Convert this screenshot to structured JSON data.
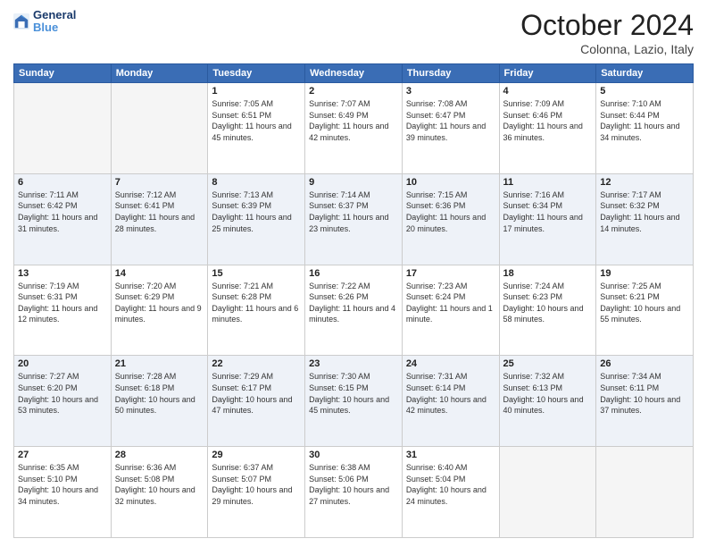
{
  "header": {
    "logo_general": "General",
    "logo_blue": "Blue",
    "month_title": "October 2024",
    "location": "Colonna, Lazio, Italy"
  },
  "days_of_week": [
    "Sunday",
    "Monday",
    "Tuesday",
    "Wednesday",
    "Thursday",
    "Friday",
    "Saturday"
  ],
  "weeks": [
    {
      "shade": false,
      "days": [
        {
          "num": "",
          "detail": ""
        },
        {
          "num": "",
          "detail": ""
        },
        {
          "num": "1",
          "detail": "Sunrise: 7:05 AM\nSunset: 6:51 PM\nDaylight: 11 hours and 45 minutes."
        },
        {
          "num": "2",
          "detail": "Sunrise: 7:07 AM\nSunset: 6:49 PM\nDaylight: 11 hours and 42 minutes."
        },
        {
          "num": "3",
          "detail": "Sunrise: 7:08 AM\nSunset: 6:47 PM\nDaylight: 11 hours and 39 minutes."
        },
        {
          "num": "4",
          "detail": "Sunrise: 7:09 AM\nSunset: 6:46 PM\nDaylight: 11 hours and 36 minutes."
        },
        {
          "num": "5",
          "detail": "Sunrise: 7:10 AM\nSunset: 6:44 PM\nDaylight: 11 hours and 34 minutes."
        }
      ]
    },
    {
      "shade": true,
      "days": [
        {
          "num": "6",
          "detail": "Sunrise: 7:11 AM\nSunset: 6:42 PM\nDaylight: 11 hours and 31 minutes."
        },
        {
          "num": "7",
          "detail": "Sunrise: 7:12 AM\nSunset: 6:41 PM\nDaylight: 11 hours and 28 minutes."
        },
        {
          "num": "8",
          "detail": "Sunrise: 7:13 AM\nSunset: 6:39 PM\nDaylight: 11 hours and 25 minutes."
        },
        {
          "num": "9",
          "detail": "Sunrise: 7:14 AM\nSunset: 6:37 PM\nDaylight: 11 hours and 23 minutes."
        },
        {
          "num": "10",
          "detail": "Sunrise: 7:15 AM\nSunset: 6:36 PM\nDaylight: 11 hours and 20 minutes."
        },
        {
          "num": "11",
          "detail": "Sunrise: 7:16 AM\nSunset: 6:34 PM\nDaylight: 11 hours and 17 minutes."
        },
        {
          "num": "12",
          "detail": "Sunrise: 7:17 AM\nSunset: 6:32 PM\nDaylight: 11 hours and 14 minutes."
        }
      ]
    },
    {
      "shade": false,
      "days": [
        {
          "num": "13",
          "detail": "Sunrise: 7:19 AM\nSunset: 6:31 PM\nDaylight: 11 hours and 12 minutes."
        },
        {
          "num": "14",
          "detail": "Sunrise: 7:20 AM\nSunset: 6:29 PM\nDaylight: 11 hours and 9 minutes."
        },
        {
          "num": "15",
          "detail": "Sunrise: 7:21 AM\nSunset: 6:28 PM\nDaylight: 11 hours and 6 minutes."
        },
        {
          "num": "16",
          "detail": "Sunrise: 7:22 AM\nSunset: 6:26 PM\nDaylight: 11 hours and 4 minutes."
        },
        {
          "num": "17",
          "detail": "Sunrise: 7:23 AM\nSunset: 6:24 PM\nDaylight: 11 hours and 1 minute."
        },
        {
          "num": "18",
          "detail": "Sunrise: 7:24 AM\nSunset: 6:23 PM\nDaylight: 10 hours and 58 minutes."
        },
        {
          "num": "19",
          "detail": "Sunrise: 7:25 AM\nSunset: 6:21 PM\nDaylight: 10 hours and 55 minutes."
        }
      ]
    },
    {
      "shade": true,
      "days": [
        {
          "num": "20",
          "detail": "Sunrise: 7:27 AM\nSunset: 6:20 PM\nDaylight: 10 hours and 53 minutes."
        },
        {
          "num": "21",
          "detail": "Sunrise: 7:28 AM\nSunset: 6:18 PM\nDaylight: 10 hours and 50 minutes."
        },
        {
          "num": "22",
          "detail": "Sunrise: 7:29 AM\nSunset: 6:17 PM\nDaylight: 10 hours and 47 minutes."
        },
        {
          "num": "23",
          "detail": "Sunrise: 7:30 AM\nSunset: 6:15 PM\nDaylight: 10 hours and 45 minutes."
        },
        {
          "num": "24",
          "detail": "Sunrise: 7:31 AM\nSunset: 6:14 PM\nDaylight: 10 hours and 42 minutes."
        },
        {
          "num": "25",
          "detail": "Sunrise: 7:32 AM\nSunset: 6:13 PM\nDaylight: 10 hours and 40 minutes."
        },
        {
          "num": "26",
          "detail": "Sunrise: 7:34 AM\nSunset: 6:11 PM\nDaylight: 10 hours and 37 minutes."
        }
      ]
    },
    {
      "shade": false,
      "days": [
        {
          "num": "27",
          "detail": "Sunrise: 6:35 AM\nSunset: 5:10 PM\nDaylight: 10 hours and 34 minutes."
        },
        {
          "num": "28",
          "detail": "Sunrise: 6:36 AM\nSunset: 5:08 PM\nDaylight: 10 hours and 32 minutes."
        },
        {
          "num": "29",
          "detail": "Sunrise: 6:37 AM\nSunset: 5:07 PM\nDaylight: 10 hours and 29 minutes."
        },
        {
          "num": "30",
          "detail": "Sunrise: 6:38 AM\nSunset: 5:06 PM\nDaylight: 10 hours and 27 minutes."
        },
        {
          "num": "31",
          "detail": "Sunrise: 6:40 AM\nSunset: 5:04 PM\nDaylight: 10 hours and 24 minutes."
        },
        {
          "num": "",
          "detail": ""
        },
        {
          "num": "",
          "detail": ""
        }
      ]
    }
  ]
}
